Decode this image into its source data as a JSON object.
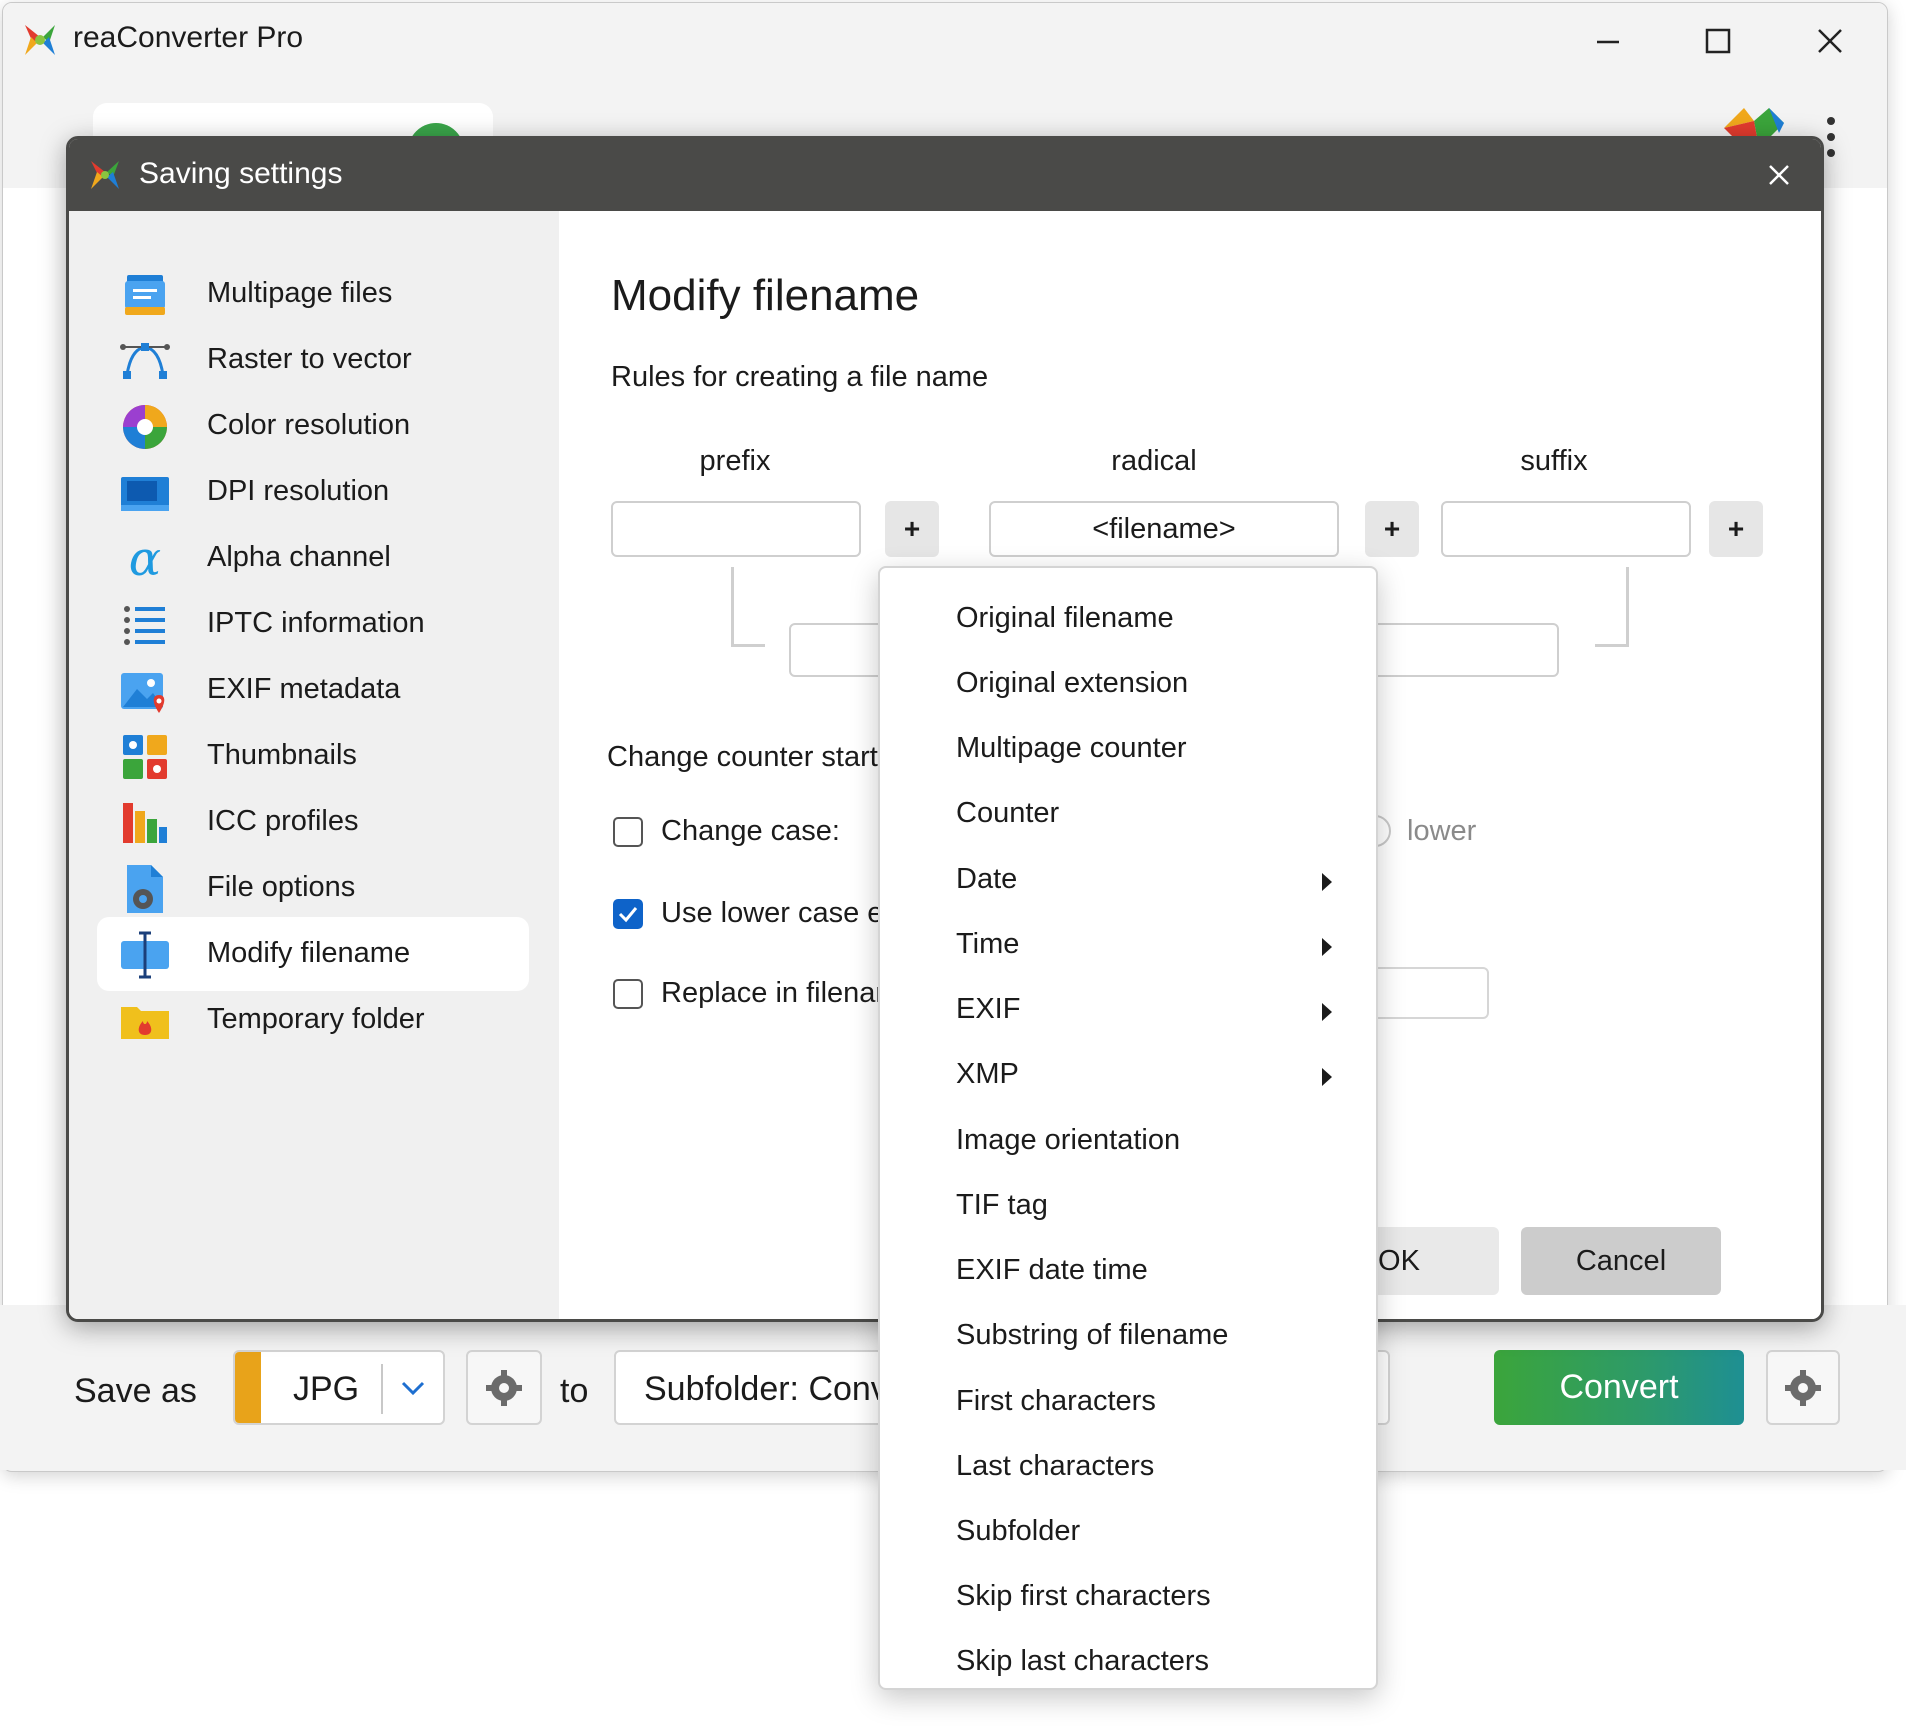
{
  "app": {
    "title": "reaConverter Pro"
  },
  "window_controls": {
    "minimize": "—",
    "maximize": "☐",
    "close": "✕"
  },
  "dialog": {
    "title": "Saving settings",
    "sidebar": {
      "items": [
        {
          "label": "Multipage files",
          "icon": "multipage-icon"
        },
        {
          "label": "Raster to vector",
          "icon": "vector-icon"
        },
        {
          "label": "Color resolution",
          "icon": "color-wheel-icon"
        },
        {
          "label": "DPI resolution",
          "icon": "dpi-icon"
        },
        {
          "label": "Alpha channel",
          "icon": "alpha-icon"
        },
        {
          "label": "IPTC information",
          "icon": "list-icon"
        },
        {
          "label": "EXIF metadata",
          "icon": "photo-pin-icon"
        },
        {
          "label": "Thumbnails",
          "icon": "thumbnails-icon"
        },
        {
          "label": "ICC profiles",
          "icon": "icc-icon"
        },
        {
          "label": "File options",
          "icon": "file-gear-icon"
        },
        {
          "label": "Modify filename",
          "icon": "text-cursor-icon",
          "active": true
        },
        {
          "label": "Temporary folder",
          "icon": "folder-fire-icon"
        }
      ]
    },
    "content": {
      "title": "Modify filename",
      "rules_label": "Rules for creating a file name",
      "columns": {
        "prefix": {
          "label": "prefix",
          "value": ""
        },
        "radical": {
          "label": "radical",
          "value": "<filename>"
        },
        "suffix": {
          "label": "suffix",
          "value": ""
        }
      },
      "plus_label": "+",
      "counter_label": "Change counter start",
      "change_case": {
        "label": "Change case:",
        "checked": false
      },
      "use_lower": {
        "label": "Use lower case e",
        "checked": true
      },
      "replace": {
        "label": "Replace in filenam",
        "checked": false
      },
      "radio_lower": "lower",
      "ok": "OK",
      "cancel": "Cancel"
    }
  },
  "menu": {
    "items": [
      {
        "label": "Original filename",
        "submenu": false
      },
      {
        "label": "Original extension",
        "submenu": false
      },
      {
        "label": "Multipage counter",
        "submenu": false
      },
      {
        "label": "Counter",
        "submenu": false
      },
      {
        "label": "Date",
        "submenu": true
      },
      {
        "label": "Time",
        "submenu": true
      },
      {
        "label": "EXIF",
        "submenu": true
      },
      {
        "label": "XMP",
        "submenu": true
      },
      {
        "label": "Image orientation",
        "submenu": false
      },
      {
        "label": "TIF tag",
        "submenu": false
      },
      {
        "label": "EXIF date time",
        "submenu": false
      },
      {
        "label": "Substring of filename",
        "submenu": false
      },
      {
        "label": "First characters",
        "submenu": false
      },
      {
        "label": "Last characters",
        "submenu": false
      },
      {
        "label": "Subfolder",
        "submenu": false
      },
      {
        "label": "Skip first characters",
        "submenu": false
      },
      {
        "label": "Skip last characters",
        "submenu": false
      }
    ]
  },
  "bottombar": {
    "save_as_label": "Save as",
    "format": "JPG",
    "to_label": "to",
    "destination": "Subfolder: Conv",
    "convert": "Convert"
  },
  "colors": {
    "accent_blue": "#0e63c9",
    "format_stripe": "#e8a31a",
    "convert_green": "#3ba53b",
    "dialog_titlebar": "#4a4a48"
  }
}
